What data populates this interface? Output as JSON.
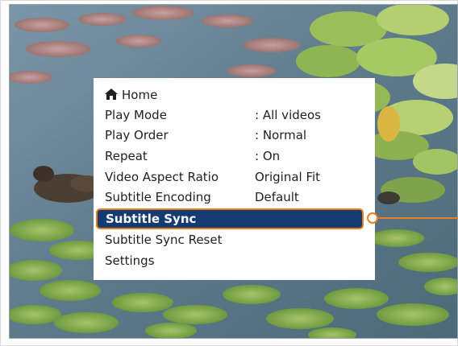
{
  "menu": {
    "home_label": "Home",
    "items": [
      {
        "label": "Play Mode",
        "value": ": All videos"
      },
      {
        "label": "Play Order",
        "value": ": Normal"
      },
      {
        "label": "Repeat",
        "value": ": On"
      },
      {
        "label": "Video Aspect Ratio",
        "value": "Original Fit"
      },
      {
        "label": "Subtitle Encoding",
        "value": "Default"
      },
      {
        "label": "Subtitle Sync",
        "value": "",
        "selected": true
      },
      {
        "label": "Subtitle Sync Reset",
        "value": ""
      },
      {
        "label": "Settings",
        "value": ""
      }
    ]
  },
  "colors": {
    "selection_bg": "#143c72",
    "selection_border": "#e8801e",
    "callout": "#e8801e"
  },
  "icons": {
    "home": "home-icon"
  }
}
